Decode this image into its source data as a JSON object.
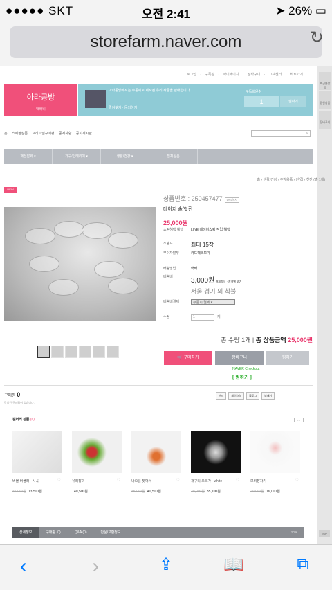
{
  "status": {
    "carrier": "●●●●● SKT",
    "time": "오전 2:41",
    "battery": "26%"
  },
  "browser": {
    "url": "storefarm.naver.com"
  },
  "store": {
    "top_links": "로그인 · 구독상 · 마이페이지 · 장바구니 · 고객센터 · 바로가기",
    "name": "아라공방",
    "name_sub": "택배비",
    "banner_text": "아라공방에서는 수공예로 제작된 유리 작품을 판매합니다.",
    "banner_footer": "즐겨찾기 · 문의하기",
    "fav_label": "구독회원수",
    "fav_count": "1",
    "fav_button": "찜하기"
  },
  "categories": [
    "홈",
    "스페셜상품",
    "프리미엄구매평",
    "공지사항",
    "공지게시판"
  ],
  "gnb": [
    "패션잡화 ▾",
    "가구/인테리어 ▾",
    "생활/건강 ▾",
    "전체상품"
  ],
  "breadcrumb": "홈 › 생활/건강 › 주방용품 › 잔/컵 › 찻잔 (총 1개)",
  "product": {
    "badge": "NEW",
    "number": "상품번호 : 250457477",
    "number_tag": "URL복사",
    "name": "데이지 술/찻잔",
    "price": "25,000원",
    "benefit_label": "쇼핑혜택 혜택",
    "benefit": "LINE 네이버쇼핑 적립 혜택",
    "stamp_label": "스탬프",
    "stamp_value": "최대 15장",
    "interest_label": "무이자할부",
    "interest_value": "카드혜택보기",
    "ship_method_label": "배송방법",
    "ship_method": "택배",
    "ship_fee_label": "배송비",
    "ship_fee": "3,000원",
    "ship_fee_tag": "결제방식 · 지역별 보기",
    "ship_note": "서울 경기 외 착불",
    "option_label": "배송비결제",
    "option_value": "주문시 결제",
    "qty_label": "수량",
    "qty": "1",
    "qty_unit": "개",
    "total_prefix": "총 수량 1개",
    "total_label": "총 상품금액",
    "total_price": "25,000원",
    "buy": "구매하기",
    "cart": "장바구니",
    "wish": "찜하기",
    "npay": "NAVER Checkout",
    "npay_sub": "[ 찜하기 ]"
  },
  "review": {
    "label": "구매평",
    "count": "0",
    "empty": "작성된 구매평이 없습니다."
  },
  "share": [
    "밴드",
    "페이스북",
    "블로그",
    "보내기"
  ],
  "gallery": {
    "title": "갤러리 상품",
    "count": "(6)",
    "nav": "‹ ›"
  },
  "goods": [
    {
      "name": "버블 버블러 - 시곡",
      "old": "45,000원",
      "price": "13,500원"
    },
    {
      "name": "유리장미",
      "old": "",
      "price": "40,500원"
    },
    {
      "name": "나오를 찾아서",
      "old": "45,000원",
      "price": "40,500원"
    },
    {
      "name": "개구리 오르가 - white",
      "old": "39,000원",
      "price": "35,100원"
    },
    {
      "name": "모비장자기",
      "old": "20,000원",
      "price": "16,000원"
    }
  ],
  "tabs": [
    "상세정보",
    "구매평 (0)",
    "Q&A (0)",
    "반품/교환정보",
    "TOP"
  ],
  "rail": [
    "최근본상품",
    "찜한상품",
    "장바구니",
    "TOP"
  ]
}
